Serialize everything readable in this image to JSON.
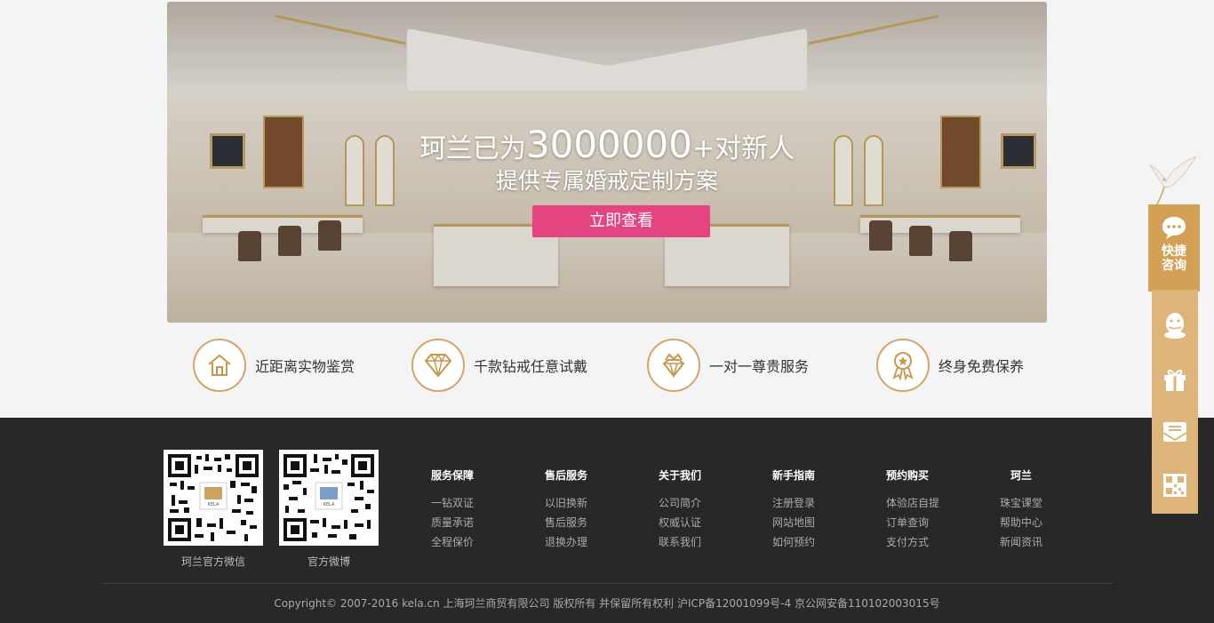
{
  "banner": {
    "headline_prefix": "珂兰已为",
    "headline_number": "3000000",
    "headline_suffix": "+对新人",
    "headline_line2": "提供专属婚戒定制方案",
    "cta_label": "立即查看",
    "cta_color": "#e4447f"
  },
  "features": [
    {
      "icon": "house-icon",
      "label": "近距离实物鉴赏"
    },
    {
      "icon": "diamond-icon",
      "label": "千款钻戒任意试戴"
    },
    {
      "icon": "crown-diamond-icon",
      "label": "一对一尊贵服务"
    },
    {
      "icon": "medal-icon",
      "label": "终身免费保养"
    }
  ],
  "footer": {
    "qr_codes": [
      {
        "caption": "珂兰官方微信"
      },
      {
        "caption": "官方微博"
      }
    ],
    "columns": [
      {
        "title": "服务保障",
        "links": [
          "一钻双证",
          "质量承诺",
          "全程保价"
        ]
      },
      {
        "title": "售后服务",
        "links": [
          "以旧换新",
          "售后服务",
          "退换办理"
        ]
      },
      {
        "title": "关于我们",
        "links": [
          "公司简介",
          "权威认证",
          "联系我们"
        ]
      },
      {
        "title": "新手指南",
        "links": [
          "注册登录",
          "网站地图",
          "如何预约"
        ]
      },
      {
        "title": "预约购买",
        "links": [
          "体验店自提",
          "订单查询",
          "支付方式"
        ]
      },
      {
        "title": "珂兰",
        "links": [
          "珠宝课堂",
          "帮助中心",
          "新闻资讯"
        ]
      }
    ],
    "copyright": "Copyright© 2007-2016 kela.cn 上海珂兰商贸有限公司 版权所有 并保留所有权利 沪ICP备12001099号-4 京公网安备110102003015号"
  },
  "sidebar": {
    "consult_label": "快捷咨询",
    "items": [
      "qq-icon",
      "gift-icon",
      "message-icon",
      "qr-code-icon"
    ],
    "accent": "#d3a155",
    "background": "#ddb57a"
  }
}
